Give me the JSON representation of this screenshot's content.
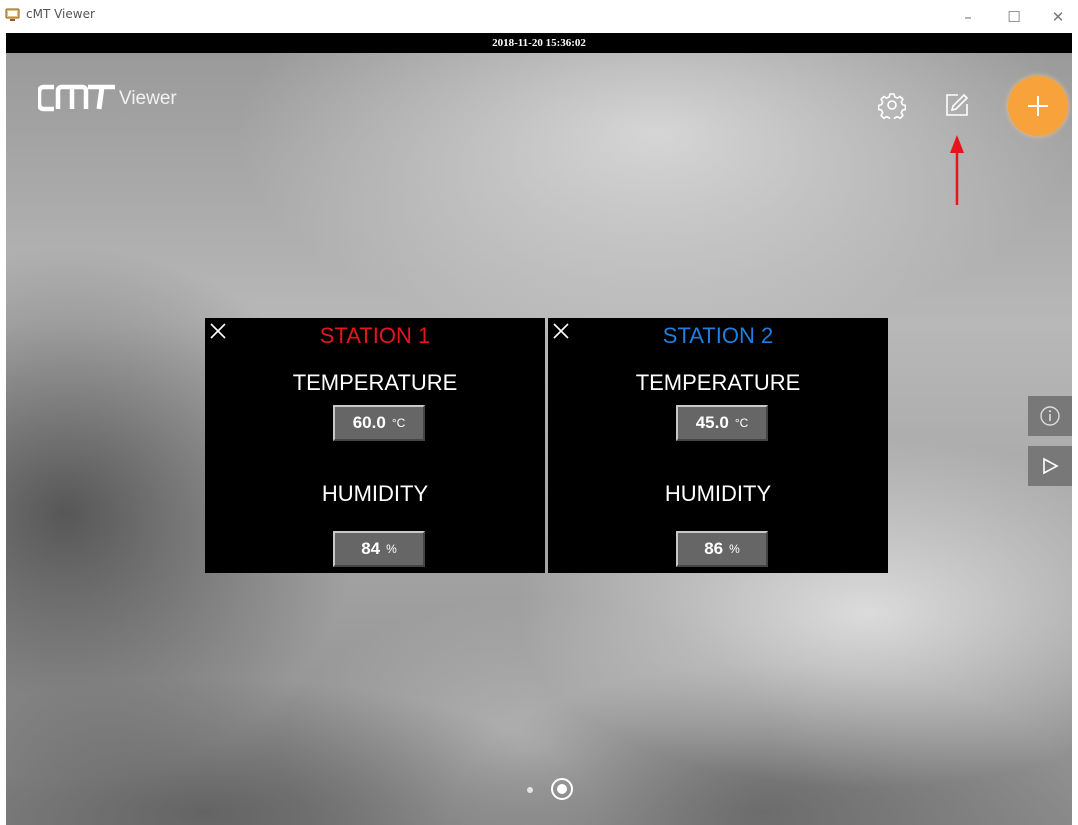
{
  "window": {
    "title": "cMT Viewer",
    "minimize": "–",
    "maximize": "☐",
    "close": "✕"
  },
  "timestamp": "2018-11-20 15:36:02",
  "logo": {
    "mark": "CMT",
    "sub": "Viewer"
  },
  "toolbar": {
    "settings_icon": "gear-icon",
    "edit_icon": "edit-icon",
    "add_icon": "plus-icon",
    "accent_color": "#f7a23a",
    "annotation_arrow_color": "#e8141c"
  },
  "stations": [
    {
      "name": "STATION 1",
      "name_color": "#e8141c",
      "temperature_label": "TEMPERATURE",
      "temperature_value": "60.0",
      "temperature_unit": "°C",
      "humidity_label": "HUMIDITY",
      "humidity_value": "84",
      "humidity_unit": "%"
    },
    {
      "name": "STATION 2",
      "name_color": "#1f7fe0",
      "temperature_label": "TEMPERATURE",
      "temperature_value": "45.0",
      "temperature_unit": "°C",
      "humidity_label": "HUMIDITY",
      "humidity_value": "86",
      "humidity_unit": "%"
    }
  ],
  "side_buttons": {
    "info_icon": "info-icon",
    "play_icon": "play-icon"
  },
  "pagination": {
    "page_count": 2,
    "current_page": 2
  }
}
